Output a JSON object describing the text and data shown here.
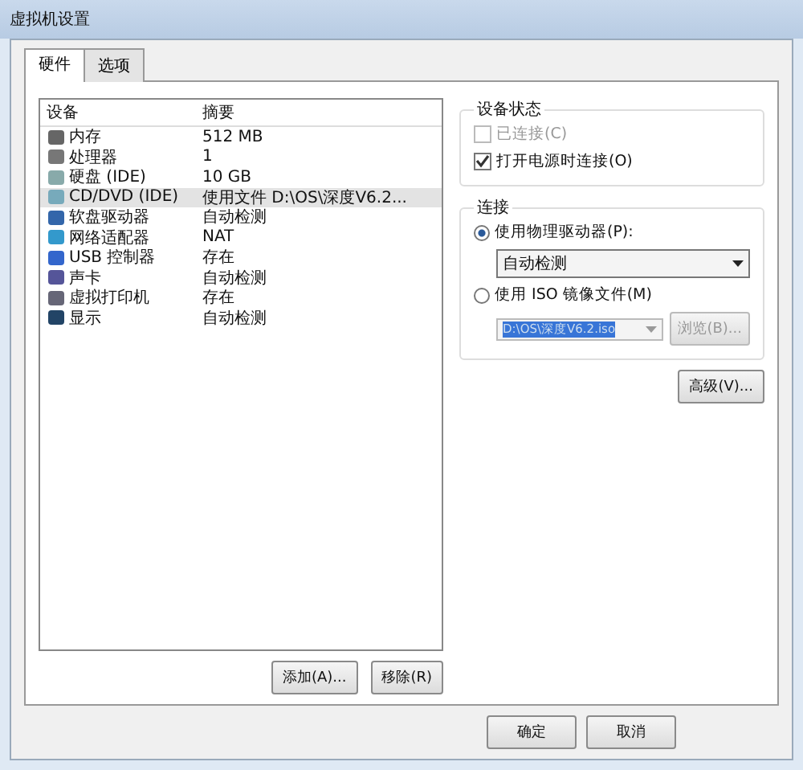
{
  "window": {
    "title": "虚拟机设置"
  },
  "tabs": [
    {
      "label": "硬件",
      "selected": true
    },
    {
      "label": "选项",
      "selected": false
    }
  ],
  "device_list": {
    "columns": [
      "设备",
      "摘要"
    ],
    "rows": [
      {
        "device": "内存",
        "summary": "512 MB",
        "selected": false
      },
      {
        "device": "处理器",
        "summary": "1",
        "selected": false
      },
      {
        "device": "硬盘 (IDE)",
        "summary": "10 GB",
        "selected": false
      },
      {
        "device": "CD/DVD (IDE)",
        "summary": "使用文件 D:\\OS\\深度V6.2...",
        "selected": true
      },
      {
        "device": "软盘驱动器",
        "summary": "自动检测",
        "selected": false
      },
      {
        "device": "网络适配器",
        "summary": "NAT",
        "selected": false
      },
      {
        "device": "USB 控制器",
        "summary": "存在",
        "selected": false
      },
      {
        "device": "声卡",
        "summary": "自动检测",
        "selected": false
      },
      {
        "device": "虚拟打印机",
        "summary": "存在",
        "selected": false
      },
      {
        "device": "显示",
        "summary": "自动检测",
        "selected": false
      }
    ]
  },
  "list_buttons": [
    "添加(A)...",
    "移除(R)"
  ],
  "device_status": {
    "title": "设备状态",
    "options": [
      {
        "label": "已连接(C)",
        "checked": false,
        "disabled": true
      },
      {
        "label": "打开电源时连接(O)",
        "checked": true,
        "disabled": false
      }
    ]
  },
  "connection": {
    "title": "连接",
    "options": [
      {
        "label": "使用物理驱动器(P):",
        "selected": true
      },
      {
        "label": "使用 ISO 镜像文件(M)",
        "selected": false
      }
    ],
    "drive_value": "自动检测",
    "iso_value": "D:\\OS\\深度V6.2.iso",
    "browse_button": "浏览(B)..."
  },
  "advanced_button": "高级(V)...",
  "dialog_buttons": [
    "确定",
    "取消"
  ]
}
